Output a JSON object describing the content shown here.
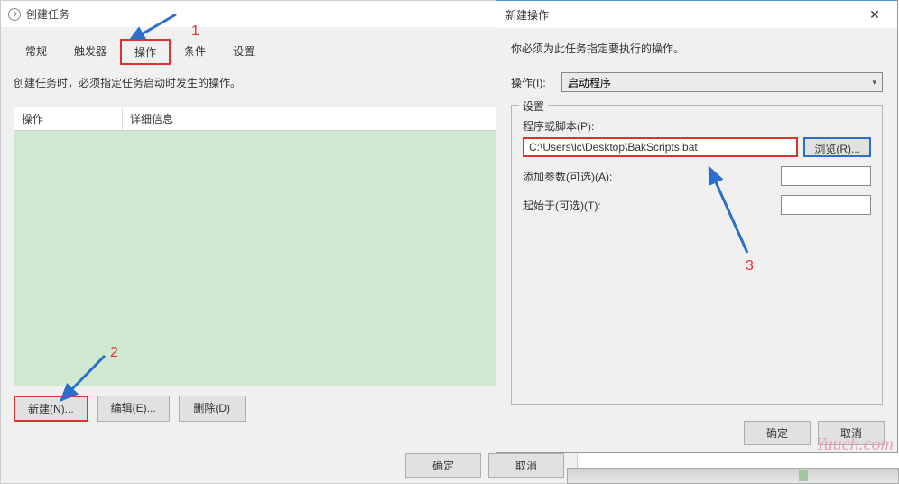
{
  "parent": {
    "title": "创建任务",
    "tabs": [
      "常规",
      "触发器",
      "操作",
      "条件",
      "设置"
    ],
    "active_tab_index": 2,
    "instruction": "创建任务时，必须指定任务启动时发生的操作。",
    "columns": {
      "action": "操作",
      "detail": "详细信息"
    },
    "buttons": {
      "new": "新建(N)...",
      "edit": "编辑(E)...",
      "delete": "删除(D)"
    },
    "footer": {
      "ok": "确定",
      "cancel": "取消"
    }
  },
  "child": {
    "title": "新建操作",
    "instruction": "你必须为此任务指定要执行的操作。",
    "action_label": "操作(I):",
    "action_value": "启动程序",
    "group_label": "设置",
    "program_label": "程序或脚本(P):",
    "program_value": "C:\\Users\\lc\\Desktop\\BakScripts.bat",
    "browse_label": "浏览(R)...",
    "args_label": "添加参数(可选)(A):",
    "args_value": "",
    "start_in_label": "起始于(可选)(T):",
    "start_in_value": "",
    "footer": {
      "ok": "确定",
      "cancel": "取消"
    }
  },
  "annotations": {
    "one": "1",
    "two": "2",
    "three": "3"
  },
  "watermark": "Yuuch.com"
}
